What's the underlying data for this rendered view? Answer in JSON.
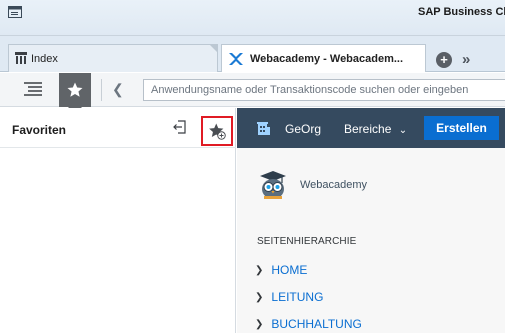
{
  "window": {
    "title": "SAP Business Cli",
    "icon": "window-menu-icon"
  },
  "tabs": [
    {
      "label": "Index",
      "icon": "tree-icon",
      "active": false
    },
    {
      "label": "Webacademy - Webacadem...",
      "icon": "sap-icon",
      "active": true
    }
  ],
  "tab_actions": {
    "add_icon": "+",
    "more_icon": "»"
  },
  "toolbar": {
    "search_placeholder": "Anwendungsname oder Transaktionscode suchen oder eingeben"
  },
  "favorites": {
    "title": "Favoriten"
  },
  "web": {
    "nav": {
      "geo_label": "GeOrg",
      "areas_label": "Bereiche",
      "areas_caret": "⌄",
      "create_label": "Erstellen"
    },
    "brand_name": "Webacademy",
    "hierarchy": {
      "title": "SEITENHIERARCHIE",
      "items": [
        "HOME",
        "LEITUNG",
        "BUCHHALTUNG"
      ]
    }
  },
  "colors": {
    "accent": "#0a6ed1",
    "nav_bg": "#354a5f",
    "highlight": "#e01b24"
  }
}
